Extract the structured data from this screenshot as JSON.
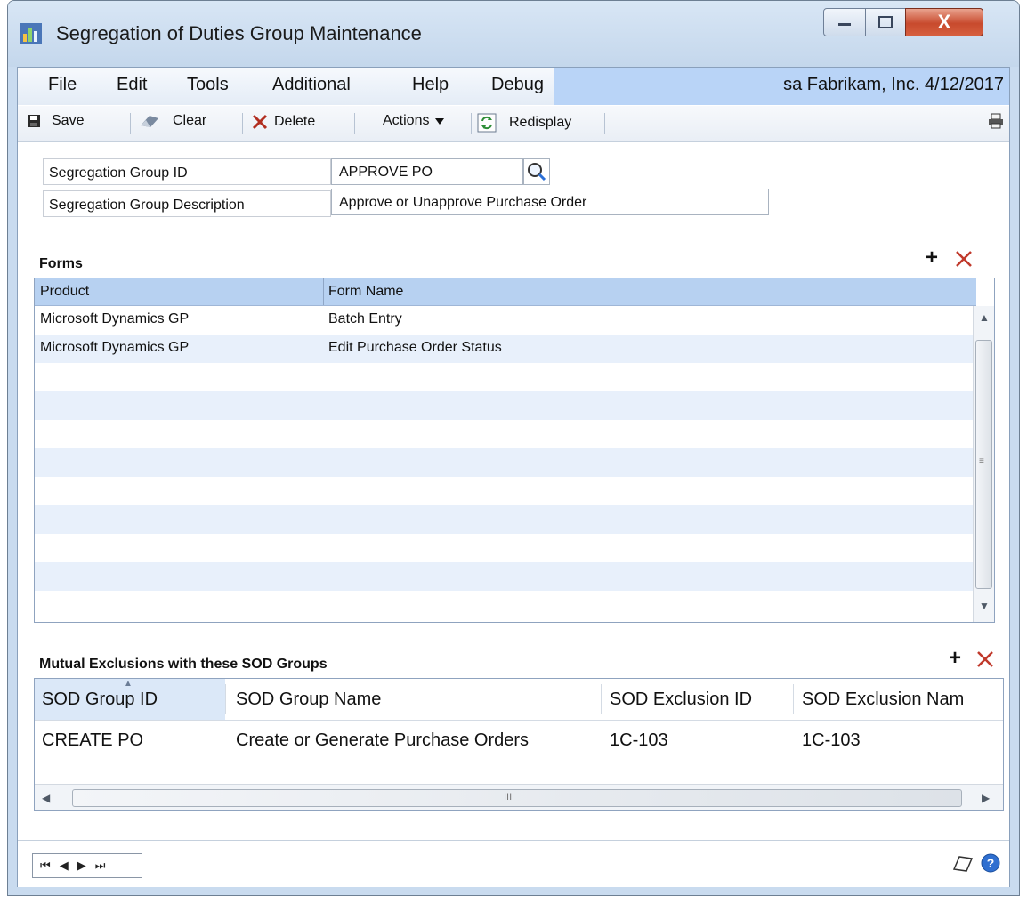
{
  "window": {
    "title": "Segregation of Duties Group Maintenance",
    "close_glyph": "X"
  },
  "menu": {
    "items": [
      "File",
      "Edit",
      "Tools",
      "Additional",
      "Help",
      "Debug"
    ],
    "company_info": "sa  Fabrikam, Inc.  4/12/2017"
  },
  "toolbar": {
    "save_label": "Save",
    "clear_label": "Clear",
    "delete_label": "Delete",
    "actions_label": "Actions",
    "redisplay_label": "Redisplay"
  },
  "form": {
    "group_id_label": "Segregation Group ID",
    "group_id_value": "APPROVE PO",
    "group_desc_label": "Segregation Group Description",
    "group_desc_value": "Approve or Unapprove Purchase Order"
  },
  "forms_grid": {
    "title": "Forms",
    "columns": [
      "Product",
      "Form Name"
    ],
    "rows": [
      [
        "Microsoft Dynamics GP",
        "Batch Entry"
      ],
      [
        "Microsoft Dynamics GP",
        "Edit Purchase Order Status"
      ]
    ],
    "stripe_color": "#e8f0fb"
  },
  "exclusions_grid": {
    "title": "Mutual Exclusions with these SOD Groups",
    "columns": [
      "SOD Group ID",
      "SOD Group Name",
      "SOD Exclusion ID",
      "SOD Exclusion Nam"
    ],
    "rows": [
      [
        "CREATE PO",
        "Create or Generate Purchase Orders",
        "1C-103",
        "1C-103"
      ]
    ],
    "hscroll_thumb_glyph": "III"
  },
  "colors": {
    "accent_header": "#b7d1f1",
    "company_bar": "#b9d4f7",
    "delete_red": "#c0392b"
  }
}
